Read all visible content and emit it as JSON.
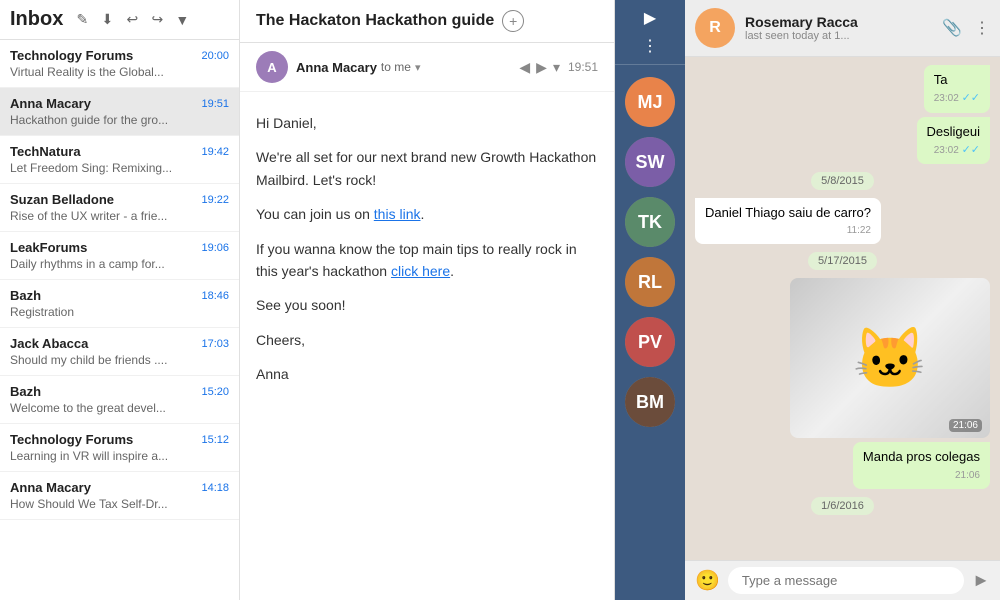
{
  "inbox": {
    "title": "Inbox",
    "icons": [
      "✏",
      "⬇",
      "↩",
      "↪",
      "⬇"
    ]
  },
  "emailList": {
    "items": [
      {
        "sender": "Technology Forums",
        "time": "20:00",
        "preview": "Virtual Reality is the Global..."
      },
      {
        "sender": "Anna Macary",
        "time": "19:51",
        "preview": "Hackathon guide for the gro...",
        "selected": true
      },
      {
        "sender": "TechNatura",
        "time": "19:42",
        "preview": "Let Freedom Sing: Remixing..."
      },
      {
        "sender": "Suzan Belladone",
        "time": "19:22",
        "preview": "Rise of the UX writer - a frie..."
      },
      {
        "sender": "LeakForums",
        "time": "19:06",
        "preview": "Daily rhythms in a camp for..."
      },
      {
        "sender": "Bazh",
        "time": "18:46",
        "preview": "Registration"
      },
      {
        "sender": "Jack Abacca",
        "time": "17:03",
        "preview": "Should my child be friends ...."
      },
      {
        "sender": "Bazh",
        "time": "15:20",
        "preview": "Welcome to the great devel..."
      },
      {
        "sender": "Technology Forums",
        "time": "15:12",
        "preview": "Learning in VR will inspire a..."
      },
      {
        "sender": "Anna Macary",
        "time": "14:18",
        "preview": "How Should We Tax Self-Dr..."
      }
    ]
  },
  "emailContent": {
    "subject": "The Hackaton Hackathon guide",
    "sender": "Anna Macary",
    "to": "to me",
    "timestamp": "19:51",
    "avatarInitial": "A",
    "body": {
      "greeting": "Hi Daniel,",
      "line1": "We're all set for our next brand new Growth Hackathon Mailbird. Let's rock!",
      "line2_pre": "You can join us on ",
      "link1": "this link",
      "line2_post": ".",
      "line3_pre": "If you wanna know the top main tips to really rock in this year's hackathon ",
      "link2": "click here",
      "line3_post": ".",
      "line4": "See you soon!",
      "line5": "Cheers,",
      "line6": "Anna"
    }
  },
  "chat": {
    "header": {
      "name": "Rosemary Racca",
      "status": "last seen today at 1...",
      "avatarInitial": "R"
    },
    "inputPlaceholder": "Type a message",
    "messages": [
      {
        "type": "sent",
        "text": "Ta",
        "time": "23:02",
        "checks": "✓✓"
      },
      {
        "type": "sent",
        "text": "Desligeui",
        "time": "23:02",
        "checks": "✓✓"
      },
      {
        "type": "date",
        "text": "5/8/2015"
      },
      {
        "type": "received",
        "text": "Daniel Thiago saiu de carro?",
        "time": "11:22"
      },
      {
        "type": "date",
        "text": "5/17/2015"
      },
      {
        "type": "image",
        "time": "21:06"
      },
      {
        "type": "sent",
        "text": "Manda pros colegas",
        "time": "21:06"
      },
      {
        "type": "date",
        "text": "1/6/2016"
      }
    ],
    "contacts": [
      {
        "initials": "MJ",
        "color": "#e8834a"
      },
      {
        "initials": "SW",
        "color": "#7b5ea7"
      },
      {
        "initials": "TK",
        "color": "#5a8a6a"
      },
      {
        "initials": "RL",
        "color": "#c0763a"
      },
      {
        "initials": "PV",
        "color": "#c0504d"
      },
      {
        "initials": "BM",
        "color": "#6b4c3b"
      }
    ]
  }
}
